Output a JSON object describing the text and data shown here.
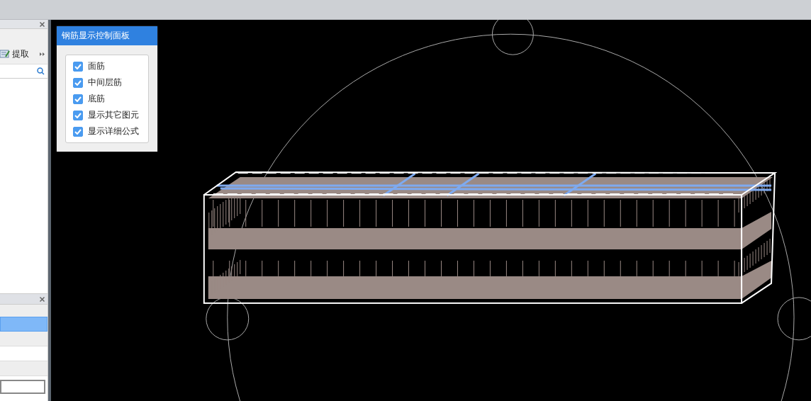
{
  "left_panel": {
    "toolbar": {
      "extract_label": "提取"
    }
  },
  "lower_panel": {
    "rows": [
      {
        "selected": true
      },
      {
        "selected": false
      },
      {
        "selected": false
      },
      {
        "selected": false
      }
    ]
  },
  "control_panel": {
    "title": "钢筋显示控制面板",
    "options": [
      {
        "label": "面筋",
        "checked": true
      },
      {
        "label": "中间层筋",
        "checked": true
      },
      {
        "label": "底筋",
        "checked": true
      },
      {
        "label": "显示其它图元",
        "checked": true
      },
      {
        "label": "显示详细公式",
        "checked": true
      }
    ]
  }
}
